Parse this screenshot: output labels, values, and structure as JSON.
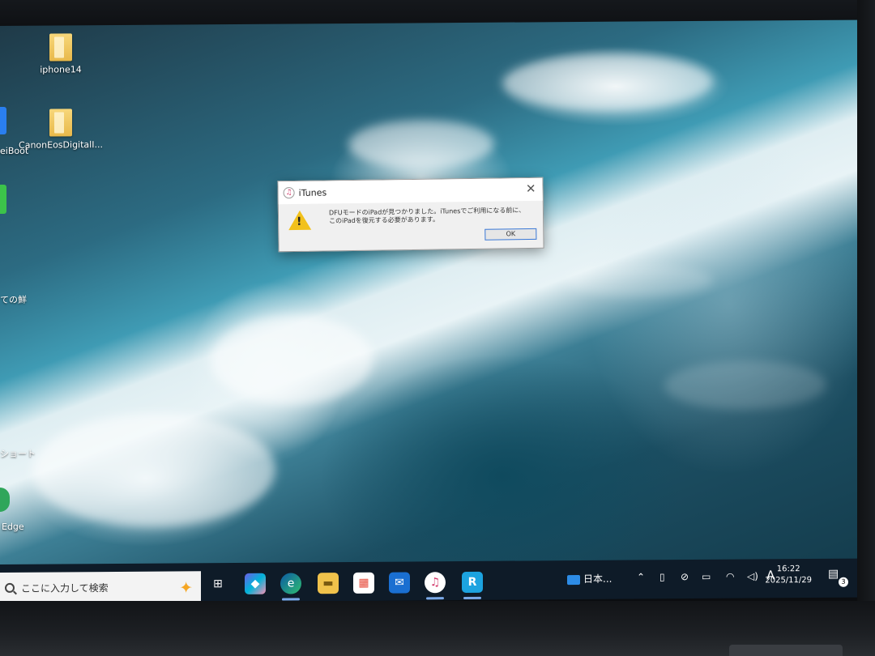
{
  "desktop": {
    "icons": [
      {
        "label": "iphone14"
      },
      {
        "label": "CanonEosDigitalI..."
      }
    ],
    "cut_labels": [
      "eiBoot",
      "ての鮮",
      "ショート",
      "Edge"
    ]
  },
  "dialog": {
    "title": "iTunes",
    "message": "DFUモードのiPadが見つかりました。iTunesでご利用になる前に、このiPadを復元する必要があります。",
    "ok_label": "OK",
    "close_glyph": "✕"
  },
  "taskbar": {
    "search_placeholder": "ここに入力して検索",
    "apps": [
      {
        "name": "task-view",
        "glyph": "⊞"
      },
      {
        "name": "copilot",
        "glyph": "◆"
      },
      {
        "name": "edge",
        "glyph": "e"
      },
      {
        "name": "file-explorer",
        "glyph": "▬"
      },
      {
        "name": "store",
        "glyph": "▦"
      },
      {
        "name": "outlook",
        "glyph": "✉"
      },
      {
        "name": "itunes",
        "glyph": "♫"
      },
      {
        "name": "app-r",
        "glyph": "R"
      }
    ],
    "language": "日本...",
    "ime_indicator": "A",
    "time": "16:22",
    "date": "2025/11/29",
    "notification_count": "3"
  },
  "colors": {
    "taskbar_bg": "#0e1b28",
    "dialog_bg": "#f0f0f0",
    "warning_yellow": "#f2c11c",
    "accent_blue": "#3a78d6"
  }
}
